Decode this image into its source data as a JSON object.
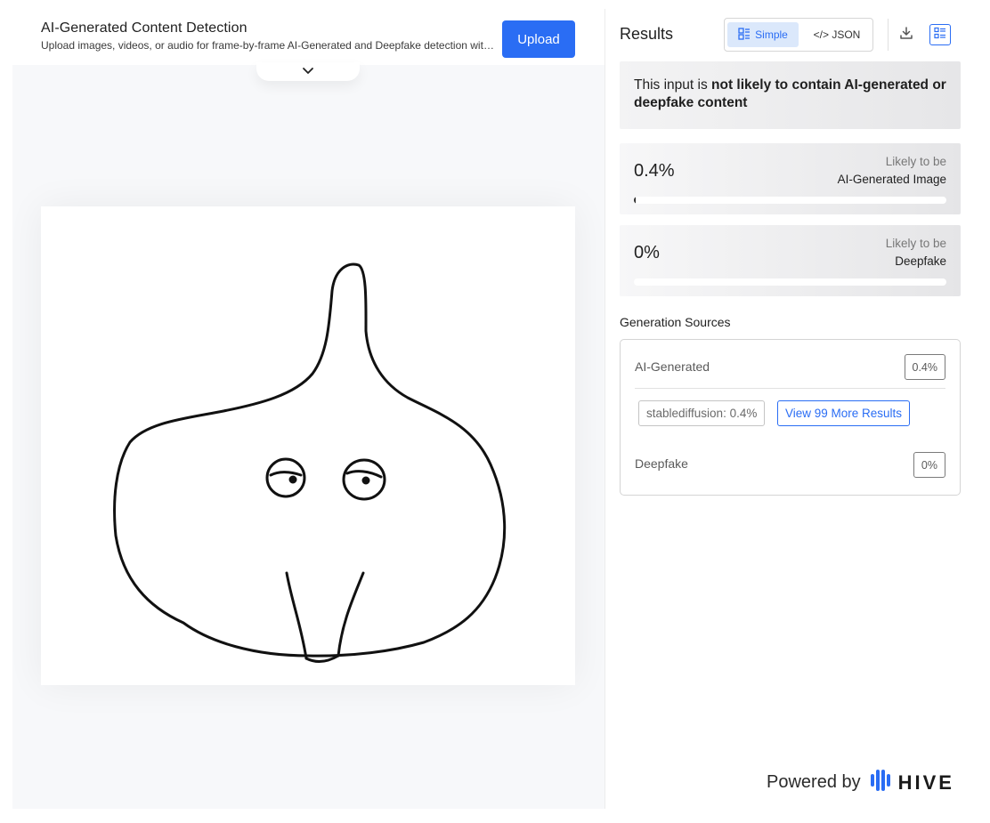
{
  "header": {
    "title": "AI-Generated Content Detection",
    "subtitle": "Upload images, videos, or audio for frame-by-frame AI-Generated and Deepfake detection with…",
    "upload_label": "Upload"
  },
  "results": {
    "title": "Results",
    "view_simple": "Simple",
    "view_json": "</> JSON",
    "summary_prefix": "This input is ",
    "summary_bold": "not likely to contain AI-generated or deepfake content",
    "cards": [
      {
        "percent": "0.4%",
        "value": 0.004,
        "likely": "Likely to be",
        "label": "AI-Generated Image"
      },
      {
        "percent": "0%",
        "value": 0.0,
        "likely": "Likely to be",
        "label": "Deepfake"
      }
    ]
  },
  "generation_sources": {
    "title": "Generation Sources",
    "ai_label": "AI-Generated",
    "ai_value": "0.4%",
    "source_chip": "stablediffusion: 0.4%",
    "more_label": "View 99 More Results",
    "deepfake_label": "Deepfake",
    "deepfake_value": "0%"
  },
  "footer": {
    "powered_by": "Powered by",
    "brand": "HIVE"
  },
  "colors": {
    "accent": "#2a6df4",
    "bar_fill": "#2a2a2a"
  },
  "icons": {
    "collapse": "chevron-down-icon",
    "simple": "layout-list-icon",
    "download": "download-icon",
    "list_view": "list-view-icon",
    "brand": "hive-logo-icon"
  }
}
